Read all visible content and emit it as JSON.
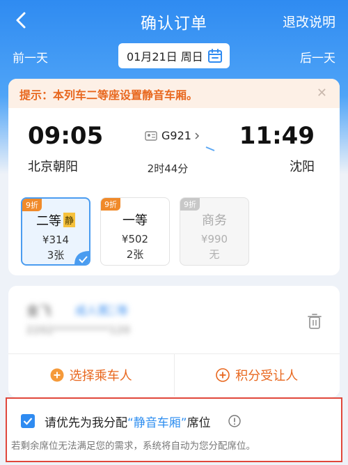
{
  "nav": {
    "title": "确认订单",
    "right_label": "退改说明"
  },
  "datebar": {
    "prev_label": "前一天",
    "next_label": "后一天",
    "date": "01月21日 周日"
  },
  "notice": {
    "text": "提示：本列车二等座设置静音车厢。",
    "close_glyph": "✕"
  },
  "train": {
    "departure_time": "09:05",
    "departure_station": "北京朝阳",
    "arrival_time": "11:49",
    "arrival_station": "沈阳",
    "train_no": "G921",
    "duration": "2时44分"
  },
  "seats": [
    {
      "discount": "9折",
      "name": "二等",
      "tag": "静",
      "price": "¥314",
      "count": "3张",
      "selected": true
    },
    {
      "discount": "9折",
      "name": "一等",
      "price": "¥502",
      "count": "2张",
      "selected": false
    },
    {
      "discount": "9折",
      "name": "商务",
      "price": "¥990",
      "count": "无",
      "selected": false,
      "disabled": true
    }
  ],
  "passenger": {
    "name": "金飞",
    "type": "成人票",
    "seat": "二等",
    "id_masked": "2202**********120"
  },
  "actions": {
    "select_passenger": "选择乘车人",
    "points_transfer": "积分受让人"
  },
  "preference": {
    "label_prefix": "请优先为我分配",
    "label_highlight": "“静音车厢”",
    "label_suffix": "席位",
    "note": "若剩余席位无法满足您的需求，系统将自动为您分配席位。",
    "checked": true
  },
  "colors": {
    "brand_blue": "#2f8bf1",
    "accent_orange": "#e8671e",
    "highlight_red": "#e0473b"
  }
}
